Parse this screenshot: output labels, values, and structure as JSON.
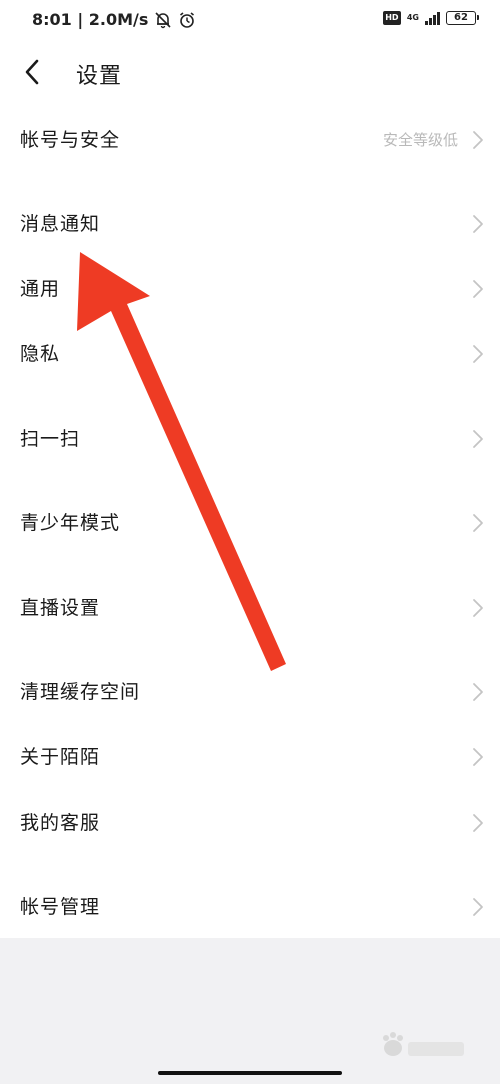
{
  "status_bar": {
    "time_speed": "8:01 | 2.0M/s",
    "hd_badge": "HD",
    "network": "4G",
    "battery": "62"
  },
  "header": {
    "title": "设置"
  },
  "settings": {
    "items": [
      {
        "label": "帐号与安全",
        "value": "安全等级低"
      },
      {
        "label": "消息通知"
      },
      {
        "label": "通用"
      },
      {
        "label": "隐私"
      },
      {
        "label": "扫一扫"
      },
      {
        "label": "青少年模式"
      },
      {
        "label": "直播设置"
      },
      {
        "label": "清理缓存空间"
      },
      {
        "label": "关于陌陌"
      },
      {
        "label": "我的客服"
      },
      {
        "label": "帐号管理"
      }
    ]
  },
  "colors": {
    "arrow": "#ee3b24",
    "secondary_text": "#b9b9b9",
    "chevron": "#c4c4c4",
    "bottom_background": "#f1f1f3"
  },
  "icons": {
    "mute": "bell-off-icon",
    "alarm": "alarm-clock-icon",
    "back": "chevron-left-icon",
    "row_arrow": "chevron-right-icon"
  }
}
